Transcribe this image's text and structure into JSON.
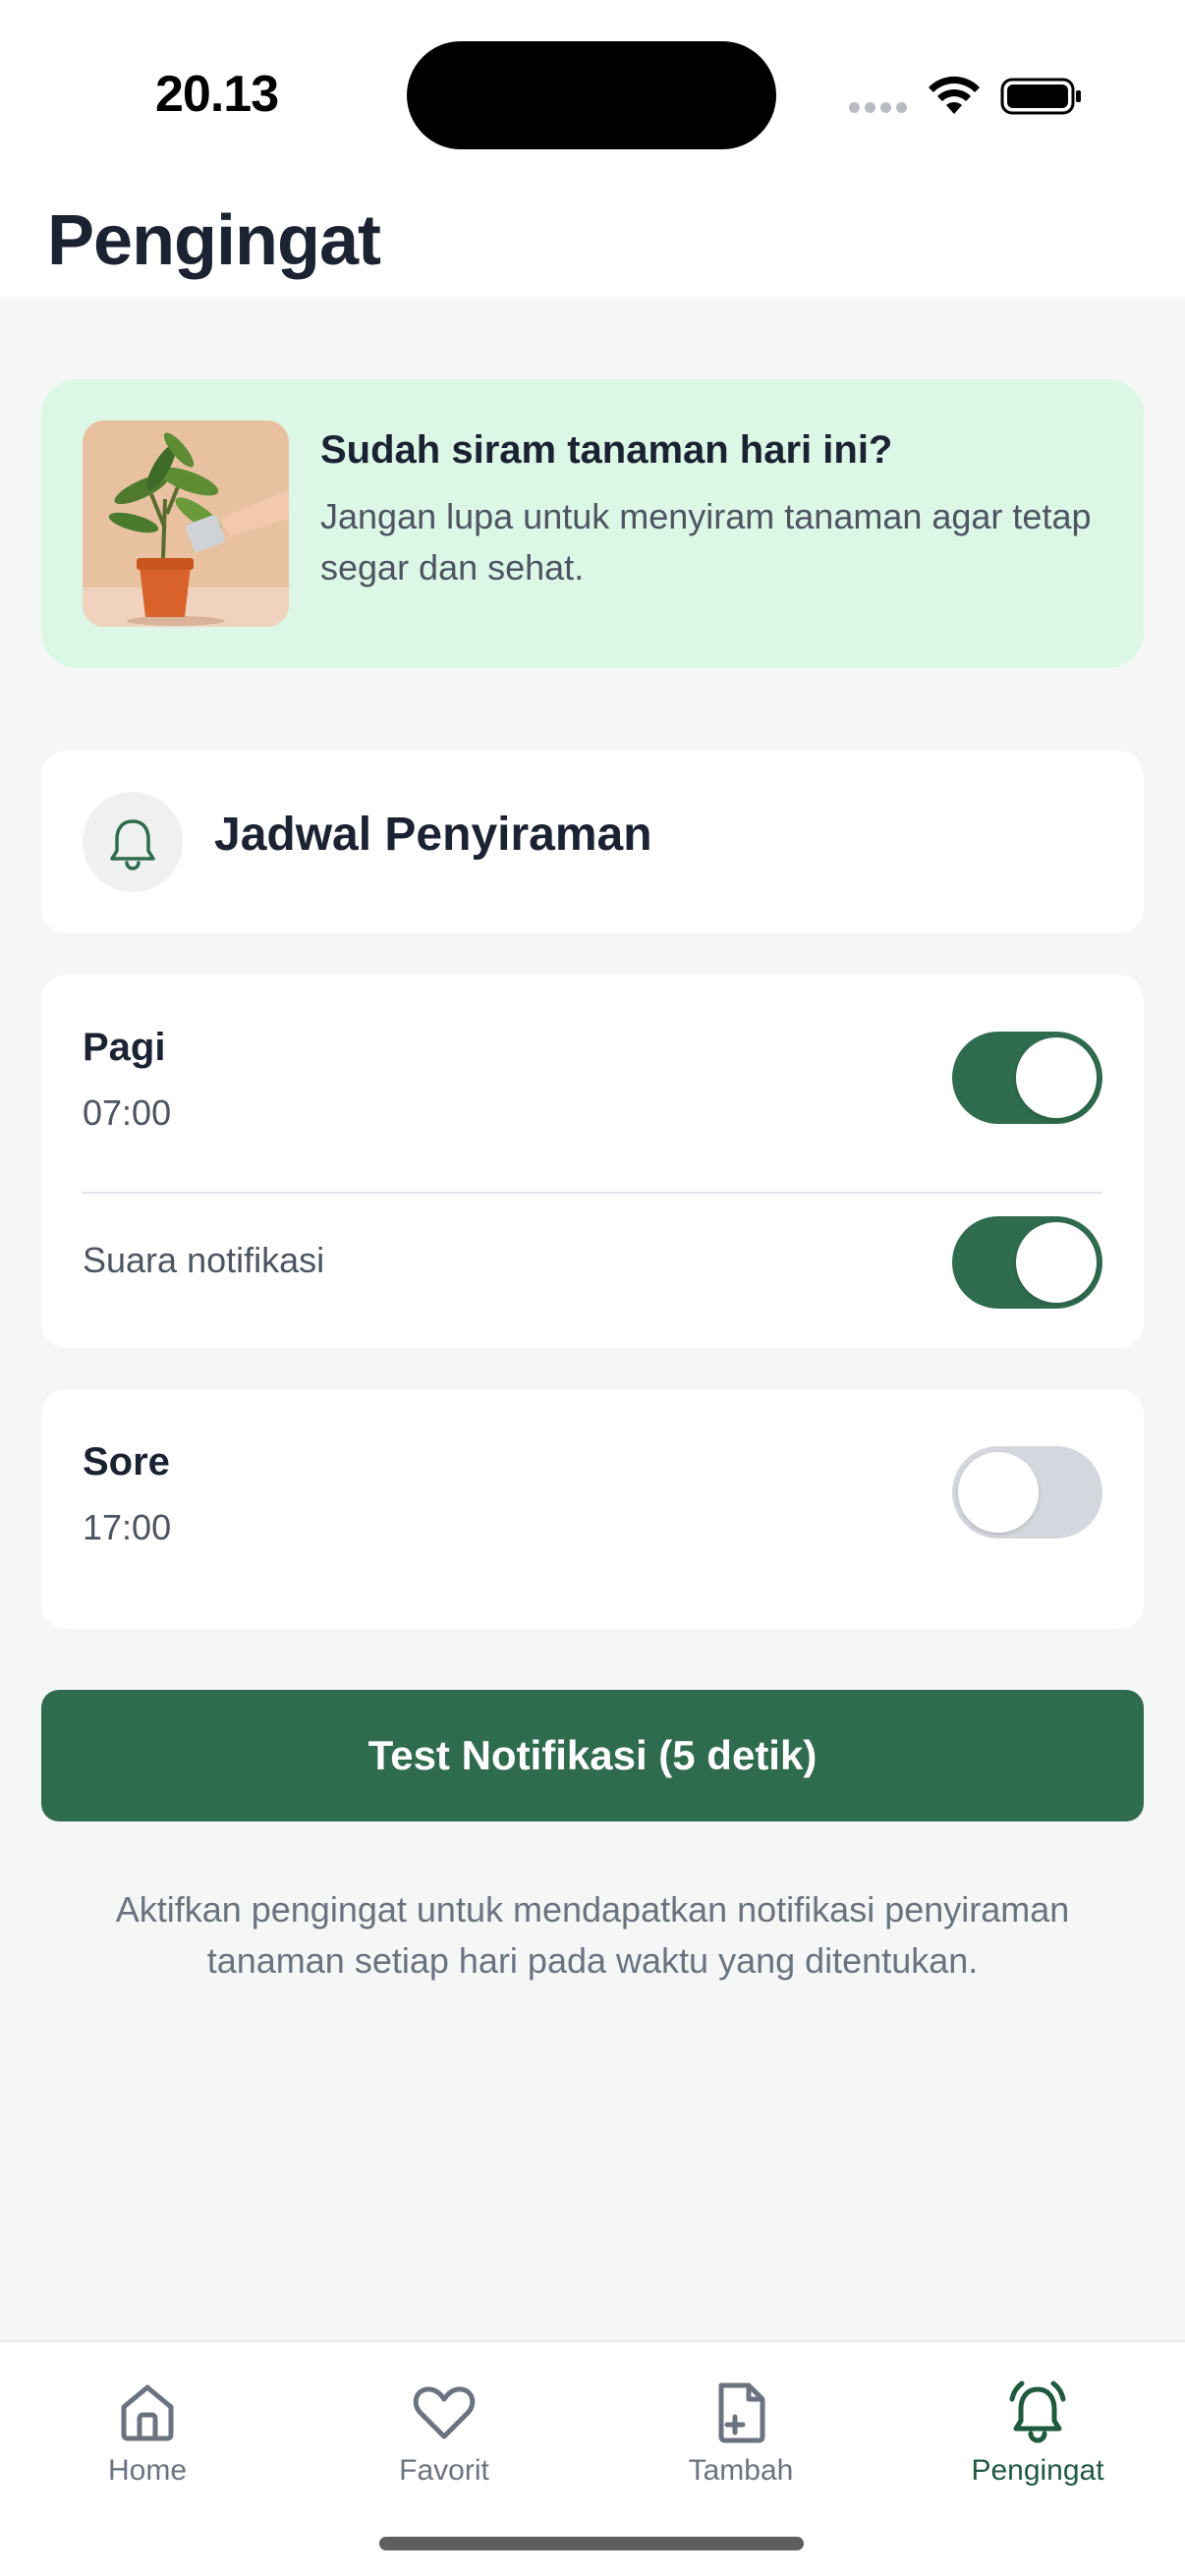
{
  "status_bar": {
    "time": "20.13",
    "signal_icon": "cellular-signal-icon",
    "wifi_icon": "wifi-icon",
    "battery_icon": "battery-full-icon"
  },
  "header": {
    "title": "Pengingat"
  },
  "promo": {
    "image_icon": "watering-plant-photo",
    "title": "Sudah siram tanaman hari ini?",
    "description": "Jangan lupa untuk menyiram tanaman agar tetap segar dan sehat."
  },
  "schedule_header": {
    "icon": "bell-icon",
    "title": "Jadwal Penyiraman"
  },
  "schedules": [
    {
      "label": "Pagi",
      "time": "07:00",
      "enabled": true,
      "sound_label": "Suara notifikasi",
      "sound_enabled": true
    },
    {
      "label": "Sore",
      "time": "17:00",
      "enabled": false
    }
  ],
  "test_button": {
    "label": "Test Notifikasi (5 detik)"
  },
  "info_text": "Aktifkan pengingat untuk mendapatkan notifikasi penyiraman tanaman setiap hari pada waktu yang ditentukan.",
  "tab_bar": {
    "tabs": [
      {
        "label": "Home",
        "icon": "home-icon",
        "active": false
      },
      {
        "label": "Favorit",
        "icon": "heart-icon",
        "active": false
      },
      {
        "label": "Tambah",
        "icon": "add-file-icon",
        "active": false
      },
      {
        "label": "Pengingat",
        "icon": "bell-ringing-icon",
        "active": true
      }
    ]
  },
  "colors": {
    "primary": "#2f6b4e",
    "promo_bg": "#dcf7e6",
    "background": "#f5f7f6",
    "text_dark": "#1b2333",
    "text_muted": "#6b7280",
    "toggle_off": "#d4d8de",
    "tab_active": "#1f5a3f"
  }
}
